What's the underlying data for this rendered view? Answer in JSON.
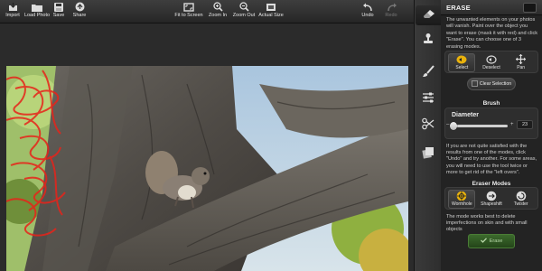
{
  "toolbar": {
    "import": "Import",
    "load_photo": "Load Photo",
    "save": "Save",
    "share": "Share",
    "fit_to_screen": "Fit to Screen",
    "zoom_in": "Zoom In",
    "zoom_out": "Zoom Out",
    "actual_size": "Actual Size",
    "undo": "Undo",
    "redo": "Redo"
  },
  "tools": [
    "eraser-icon",
    "stamp-icon",
    "brush-icon",
    "sliders-icon",
    "scissors-icon",
    "layers-icon"
  ],
  "panel": {
    "title": "ERASE",
    "intro": "The unwanted elements on your photos will vanish. Paint over the object you want to erase (mask it with red) and click \"Erase\". You can choose one of 3 erasing modes.",
    "modes": {
      "select": "Select",
      "deselect": "Deselect",
      "pan": "Pan",
      "active": "Select"
    },
    "clear_selection": "Clear Selection",
    "brush_section": "Brush",
    "diameter_label": "Diameter",
    "diameter_value": "23",
    "diameter_fraction": 0.04,
    "note": "If you are not quite satisfied with the results from one of the modes, click \"Undo\" and try another. For some areas, you will need to use the tool twice or more to get rid of the \"left overs\".",
    "eraser_modes_title": "Eraser Modes",
    "eraser_modes": {
      "wormhole": "Wormhole",
      "shapeshift": "Shapeshift",
      "twister": "Twister",
      "active": "Wormhole"
    },
    "mode_description": "The mode works best to delete imperfections on skin and with small objects",
    "erase_button": "Erase"
  },
  "colors": {
    "accent": "#e9b20c",
    "mask": "#e8231a",
    "erase_green": "#3c6a2d",
    "slider_fill": "#8fb93a"
  }
}
